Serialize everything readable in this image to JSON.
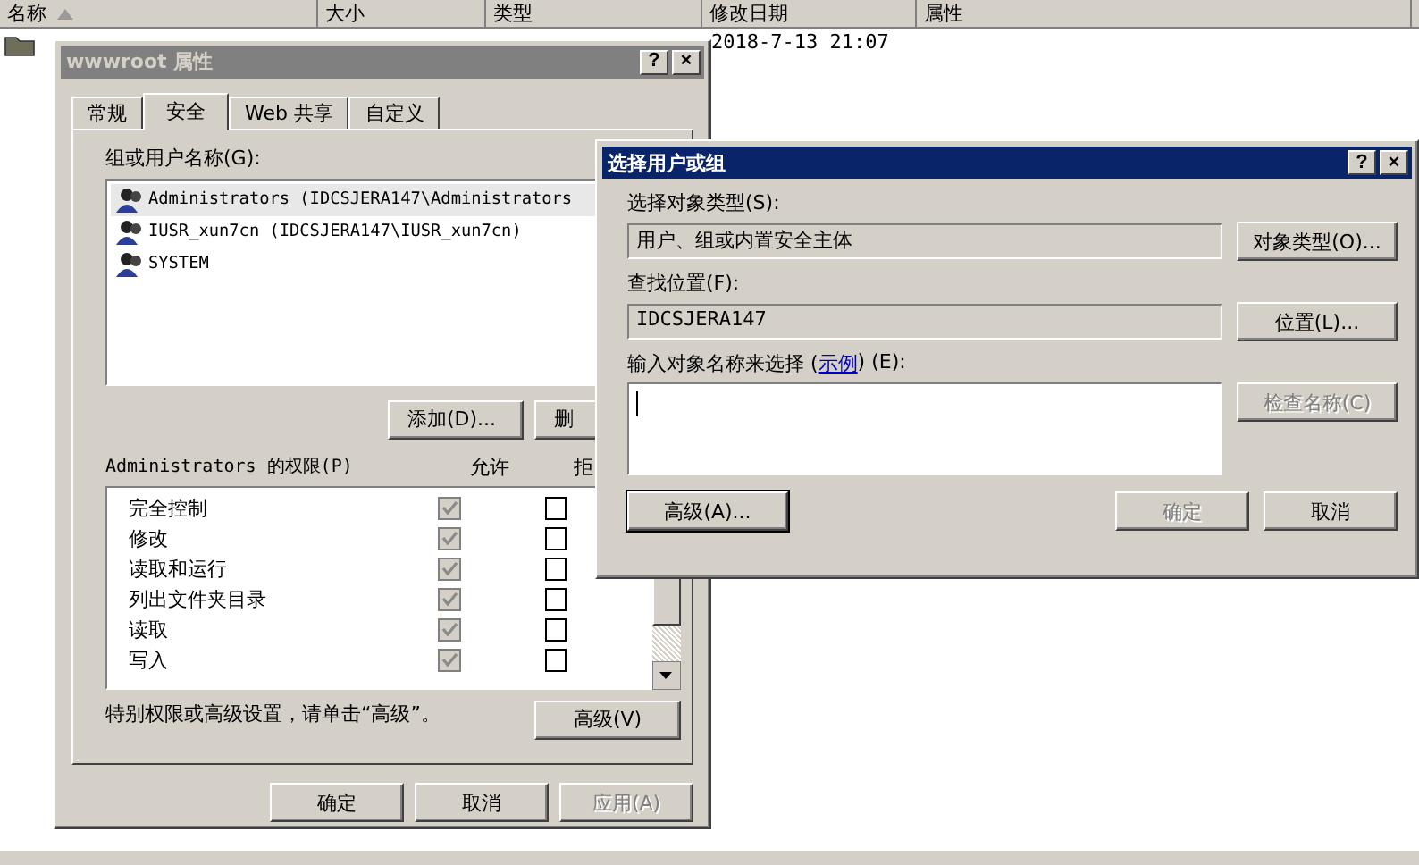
{
  "explorer": {
    "columns": [
      {
        "label": "名称",
        "sorted": true
      },
      {
        "label": "大小",
        "sorted": false
      },
      {
        "label": "类型",
        "sorted": false
      },
      {
        "label": "修改日期",
        "sorted": false
      },
      {
        "label": "属性",
        "sorted": false
      }
    ],
    "modified": "2018-7-13 21:07"
  },
  "properties_dialog": {
    "title": "wwwroot 属性",
    "help_glyph": "?",
    "close_glyph": "×",
    "tabs": [
      {
        "label": "常规",
        "selected": false
      },
      {
        "label": "安全",
        "selected": true
      },
      {
        "label": "Web 共享",
        "selected": false
      },
      {
        "label": "自定义",
        "selected": false
      }
    ],
    "users_label": "组或用户名称(G):",
    "users": [
      {
        "name": "Administrators (IDCSJERA147\\Administrators",
        "selected": true
      },
      {
        "name": "IUSR_xun7cn (IDCSJERA147\\IUSR_xun7cn)",
        "selected": false
      },
      {
        "name": "SYSTEM",
        "selected": false
      }
    ],
    "user_buttons": [
      "添加(D)...",
      "删"
    ],
    "permissions_label": "Administrators 的权限(P)",
    "allow_header": "允许",
    "deny_header": "拒",
    "permissions": [
      {
        "name": "完全控制",
        "allow": true,
        "deny": false
      },
      {
        "name": "修改",
        "allow": true,
        "deny": false
      },
      {
        "name": "读取和运行",
        "allow": true,
        "deny": false
      },
      {
        "name": "列出文件夹目录",
        "allow": true,
        "deny": false
      },
      {
        "name": "读取",
        "allow": true,
        "deny": false
      },
      {
        "name": "写入",
        "allow": true,
        "deny": false
      }
    ],
    "hint": "特别权限或高级设置，请单击“高级”。",
    "advanced_button": "高级(V)",
    "footer_buttons": [
      {
        "label": "确定",
        "disabled": false
      },
      {
        "label": "取消",
        "disabled": false
      },
      {
        "label": "应用(A)",
        "disabled": true
      }
    ]
  },
  "select_dialog": {
    "title": "选择用户或组",
    "help_glyph": "?",
    "close_glyph": "×",
    "type_label": "选择对象类型(S):",
    "type_value": "用户、组或内置安全主体",
    "type_button": "对象类型(O)...",
    "location_label": "查找位置(F):",
    "location_value": "IDCSJERA147",
    "location_button": "位置(L)...",
    "names_label_before": "输入对象名称来选择 (",
    "names_link": "示例",
    "names_label_after": ") (E):",
    "check_button": {
      "label": "检查名称(C)",
      "disabled": true
    },
    "advanced_button": "高级(A)...",
    "footer_buttons": [
      {
        "label": "确定",
        "disabled": true
      },
      {
        "label": "取消",
        "disabled": false
      }
    ]
  }
}
